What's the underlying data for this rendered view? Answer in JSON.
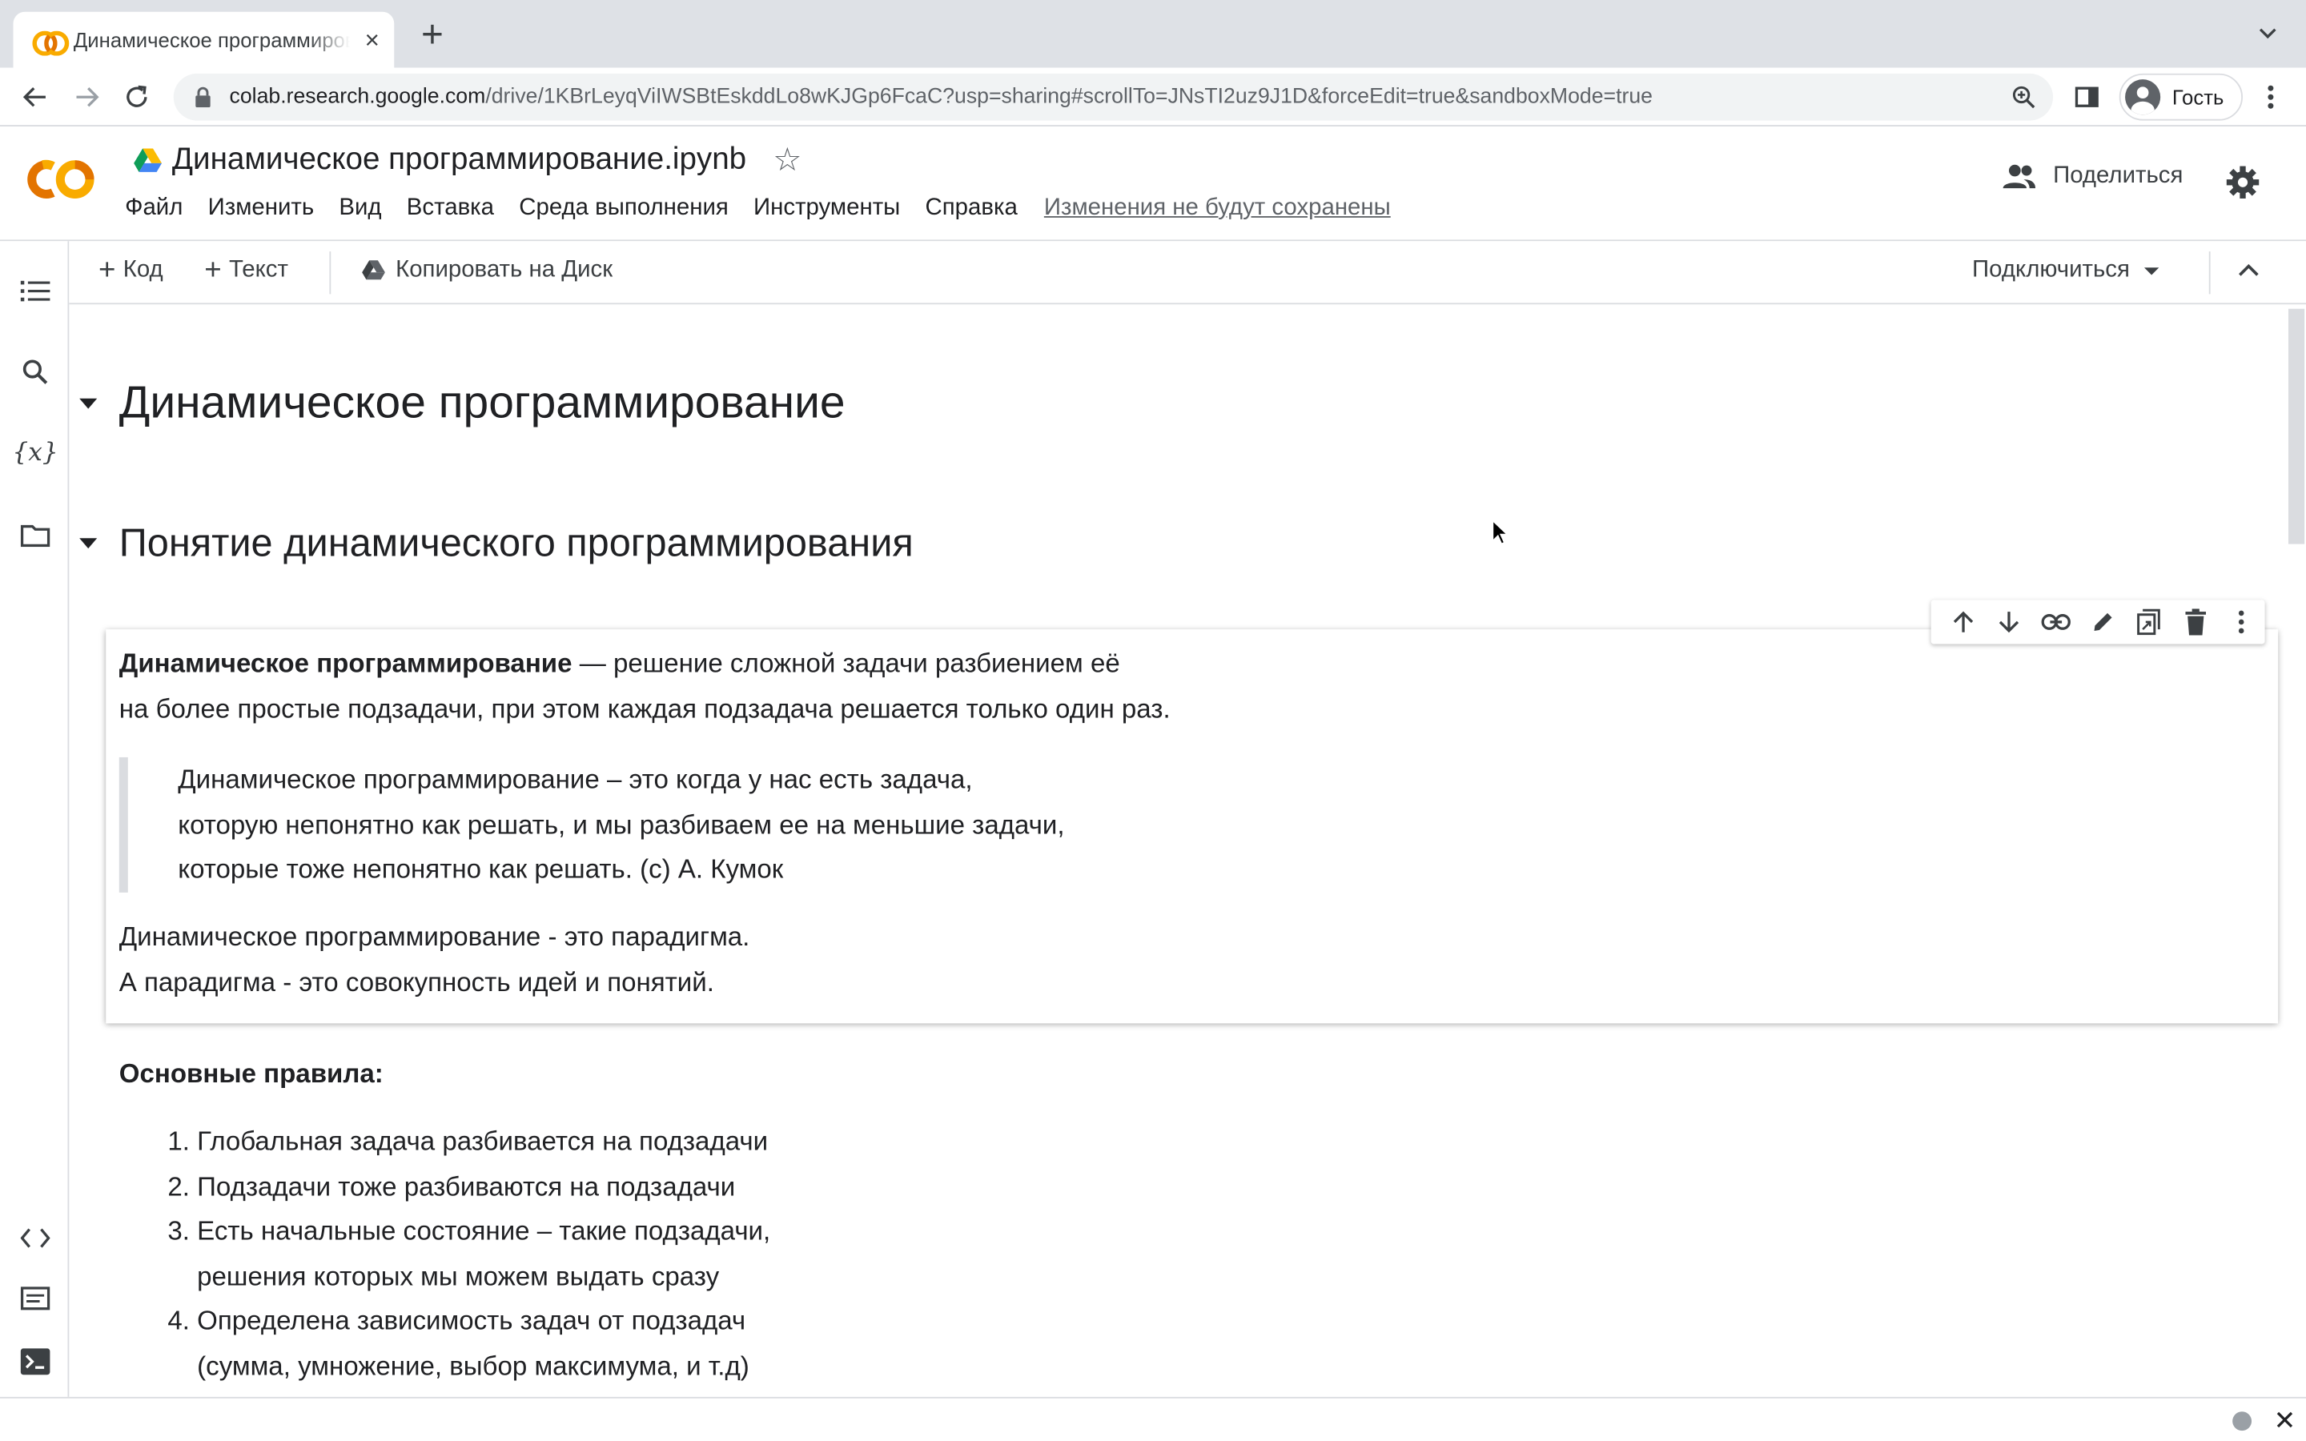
{
  "browser": {
    "tab_title": "Динамическое программирование.ipynb - Colaboratory",
    "newtab_label": "+",
    "close_label": "×",
    "url_host": "colab.research.google.com",
    "url_path": "/drive/1KBrLeyqViIWSBtEskddLo8wKJGp6FcaC?usp=sharing#scrollTo=JNsTI2uz9J1D&forceEdit=true&sandboxMode=true",
    "profile_label": "Гость"
  },
  "colab": {
    "doc_title": "Динамическое программирование.ipynb",
    "menu": [
      "Файл",
      "Изменить",
      "Вид",
      "Вставка",
      "Среда выполнения",
      "Инструменты",
      "Справка"
    ],
    "unsaved_notice": "Изменения не будут сохранены",
    "share_label": "Поделиться",
    "add_code_label": "Код",
    "add_text_label": "Текст",
    "copy_to_drive_label": "Копировать на Диск",
    "connect_label": "Подключиться",
    "rail_variables_label": "{x}"
  },
  "notebook": {
    "h1": "Динамическое программирование",
    "h2": "Понятие динамического программирования",
    "intro_bold": "Динамическое программирование",
    "intro_rest": " — решение сложной задачи разбиением её",
    "intro_line2": "на более простые подзадачи, при этом каждая подзадача решается только один раз.",
    "quote_lines": [
      "Динамическое программирование – это когда у нас есть задача,",
      "которую непонятно как решать, и мы разбиваем ее на меньшие задачи,",
      "которые тоже непонятно как решать. (с) А. Кумок"
    ],
    "para_line1": "Динамическое программирование - это парадигма.",
    "para_line2": "А парадигма - это совокупность идей и понятий.",
    "rules_title": "Основные правила:",
    "rules": [
      {
        "num": "1.",
        "lines": [
          "Глобальная задача разбивается на подзадачи"
        ]
      },
      {
        "num": "2.",
        "lines": [
          "Подзадачи тоже разбиваются на подзадачи"
        ]
      },
      {
        "num": "3.",
        "lines": [
          "Есть начальные состояние – такие подзадачи,",
          "решения которых мы можем выдать сразу"
        ]
      },
      {
        "num": "4.",
        "lines": [
          "Определена зависимость задач от подзадач",
          "(сумма, умножение, выбор максимума, и т.д)"
        ]
      }
    ]
  },
  "colors": {
    "accent_orange": "#f9ab00",
    "accent_orange_dark": "#e37400",
    "text_primary": "#202124",
    "text_secondary": "#5f6368",
    "border": "#dadce0"
  }
}
